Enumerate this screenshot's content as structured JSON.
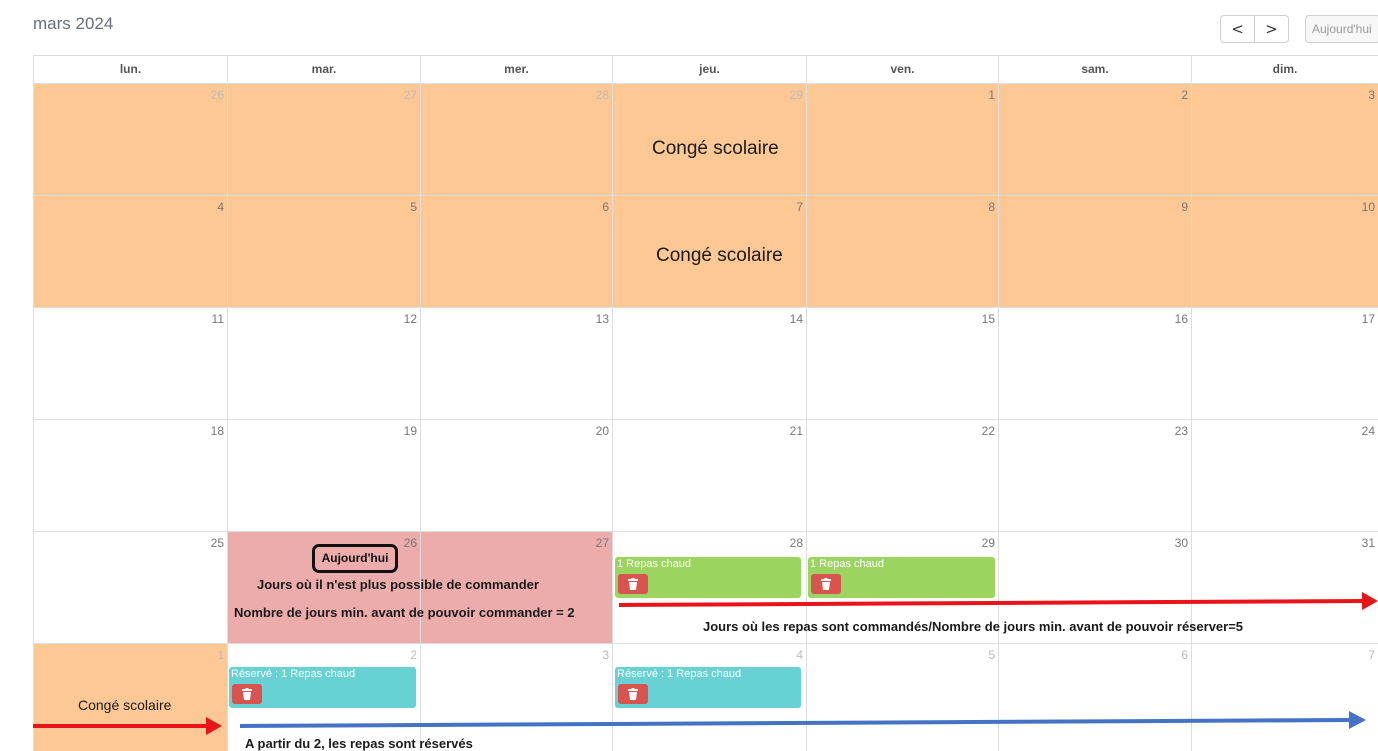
{
  "header": {
    "title": "mars 2024",
    "prev_icon": "chevron-left-icon",
    "prev_glyph": "<",
    "next_icon": "chevron-right-icon",
    "next_glyph": ">",
    "today_label": "Aujourd'hui"
  },
  "weekdays": [
    "lun.",
    "mar.",
    "mer.",
    "jeu.",
    "ven.",
    "sam.",
    "dim."
  ],
  "weeks": [
    {
      "days": [
        "26",
        "27",
        "28",
        "29",
        "1",
        "2",
        "3"
      ],
      "other_month": [
        true,
        true,
        true,
        true,
        false,
        false,
        false
      ],
      "band_label": "Congé scolaire"
    },
    {
      "days": [
        "4",
        "5",
        "6",
        "7",
        "8",
        "9",
        "10"
      ],
      "other_month": [
        false,
        false,
        false,
        false,
        false,
        false,
        false
      ],
      "band_label": "Congé scolaire"
    },
    {
      "days": [
        "11",
        "12",
        "13",
        "14",
        "15",
        "16",
        "17"
      ],
      "other_month": [
        false,
        false,
        false,
        false,
        false,
        false,
        false
      ]
    },
    {
      "days": [
        "18",
        "19",
        "20",
        "21",
        "22",
        "23",
        "24"
      ],
      "other_month": [
        false,
        false,
        false,
        false,
        false,
        false,
        false
      ]
    },
    {
      "days": [
        "25",
        "26",
        "27",
        "28",
        "29",
        "30",
        "31"
      ],
      "other_month": [
        false,
        false,
        false,
        false,
        false,
        false,
        false
      ]
    },
    {
      "days": [
        "1",
        "2",
        "3",
        "4",
        "5",
        "6",
        "7"
      ],
      "other_month": [
        true,
        true,
        true,
        true,
        true,
        true,
        true
      ],
      "band_label": "Congé scolaire"
    }
  ],
  "events": {
    "green_1": "1 Repas chaud",
    "green_2": "1 Repas chaud",
    "teal_1": "Réservé : 1 Repas chaud",
    "teal_2": "Réservé : 1 Repas chaud",
    "delete_icon": "trash-icon"
  },
  "annotations": {
    "today_badge": "Aujourd'hui",
    "no_order": "Jours où il n'est plus possible de commander",
    "min_days_order": "Nombre de jours min. avant de pouvoir commander = 2",
    "ordered_days": "Jours où les repas sont commandés/Nombre de jours min. avant de pouvoir réserver=5",
    "reserved_from": "A partir du 2, les repas sont réservés"
  },
  "colors": {
    "holiday": "#fdc893",
    "no_order": "#ecacac",
    "ordered_event": "#9bd45f",
    "reserved_event": "#67d1d4",
    "delete_button": "#d9534f",
    "arrow_red": "#e8141a",
    "arrow_blue": "#4472c4"
  }
}
